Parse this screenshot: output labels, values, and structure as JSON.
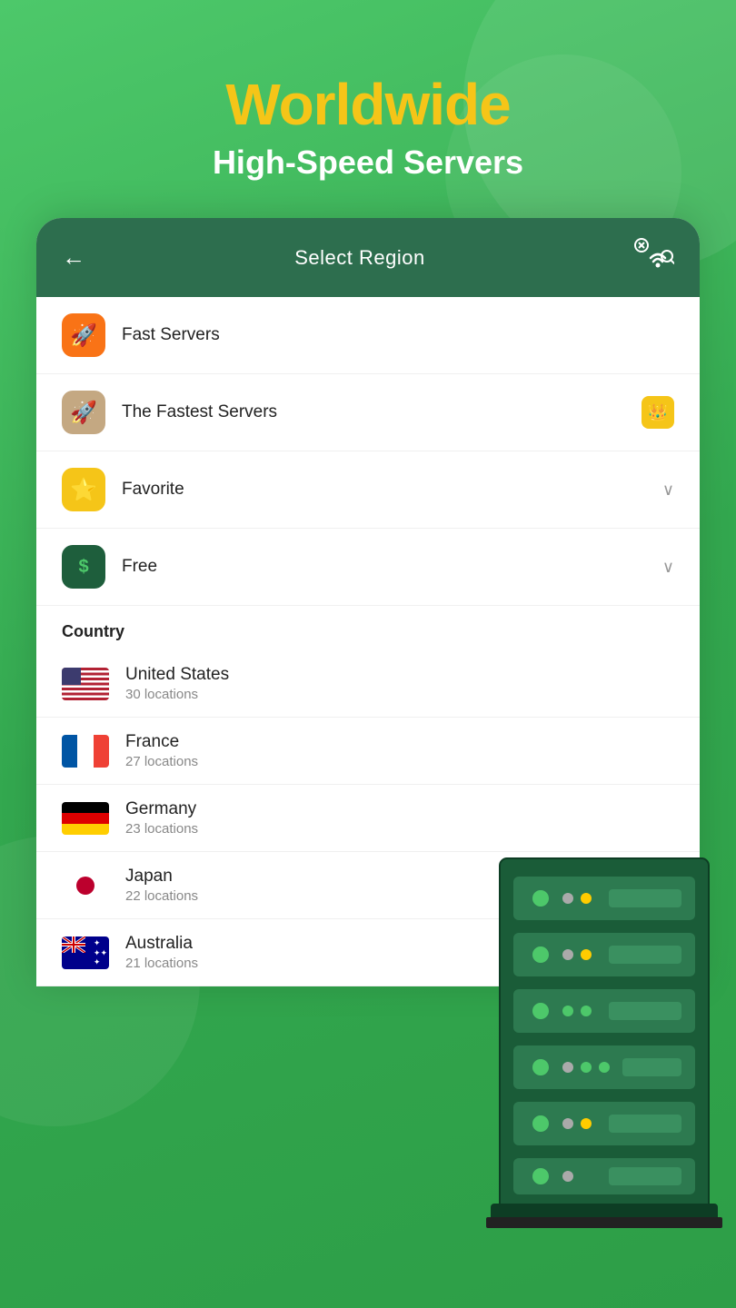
{
  "header": {
    "title": "Worldwide",
    "subtitle": "High-Speed Servers"
  },
  "card": {
    "header_title": "Select Region",
    "back_arrow": "←"
  },
  "menu_items": [
    {
      "id": "fast-servers",
      "label": "Fast Servers",
      "icon": "🚀",
      "icon_color": "orange",
      "has_crown": false,
      "has_chevron": false
    },
    {
      "id": "fastest-servers",
      "label": "The Fastest Servers",
      "icon": "🚀",
      "icon_color": "tan",
      "has_crown": true,
      "has_chevron": false
    },
    {
      "id": "favorite",
      "label": "Favorite",
      "icon": "⭐",
      "icon_color": "yellow",
      "has_crown": false,
      "has_chevron": true
    },
    {
      "id": "free",
      "label": "Free",
      "icon": "$",
      "icon_color": "dark-green",
      "has_crown": false,
      "has_chevron": true
    }
  ],
  "section_label": "Country",
  "countries": [
    {
      "id": "us",
      "name": "United States",
      "locations": "30 locations",
      "flag": "us"
    },
    {
      "id": "fr",
      "name": "France",
      "locations": "27 locations",
      "flag": "fr"
    },
    {
      "id": "de",
      "name": "Germany",
      "locations": "23 locations",
      "flag": "de"
    },
    {
      "id": "jp",
      "name": "Japan",
      "locations": "22 locations",
      "flag": "jp"
    },
    {
      "id": "au",
      "name": "Australia",
      "locations": "21 locations",
      "flag": "au"
    }
  ]
}
